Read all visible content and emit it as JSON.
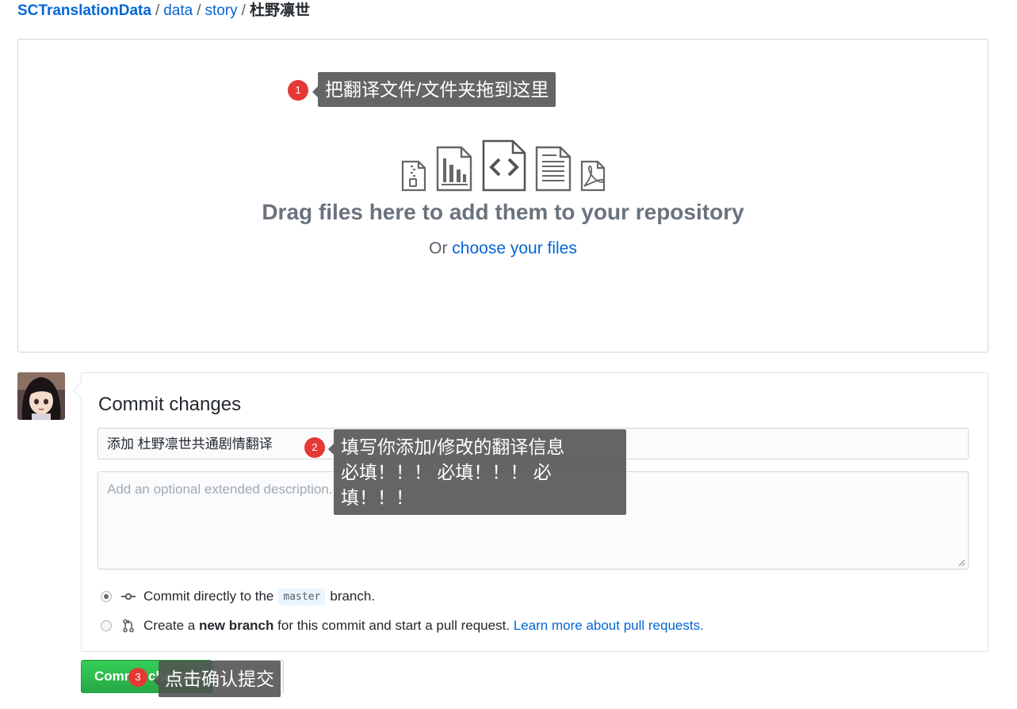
{
  "breadcrumb": {
    "repo": "SCTranslationData",
    "path": [
      "data",
      "story"
    ],
    "current": "杜野凛世",
    "separator": "/"
  },
  "dropzone": {
    "title": "Drag files here to add them to your repository",
    "or_text": "Or",
    "choose_link": "choose your files",
    "icons": [
      "file-zip-icon",
      "graph-icon",
      "file-code-icon",
      "file-text-icon",
      "file-pdf-icon"
    ]
  },
  "commit": {
    "title": "Commit changes",
    "summary_value": "添加 杜野凛世共通剧情翻译",
    "description_placeholder": "Add an optional extended description...",
    "option_direct": {
      "pre": "Commit directly to the",
      "branch": "master",
      "post": "branch."
    },
    "option_new_branch": {
      "pre": "Create a",
      "bold": "new branch",
      "post": "for this commit and start a pull request.",
      "link": "Learn more about pull requests."
    },
    "commit_button": "Commit changes"
  },
  "annotations": {
    "tip1": {
      "number": "1",
      "text": "把翻译文件/文件夹拖到这里"
    },
    "tip2": {
      "number": "2",
      "line1": "填写你添加/修改的翻译信息",
      "line2": "必填！！！ 必填！！！ 必填！！！"
    },
    "tip3": {
      "number": "3",
      "text": "点击确认提交"
    }
  },
  "colors": {
    "link": "#0366d6",
    "commit_green": "#28a745",
    "badge_red": "#e53935",
    "tooltip_bg": "#505050"
  }
}
